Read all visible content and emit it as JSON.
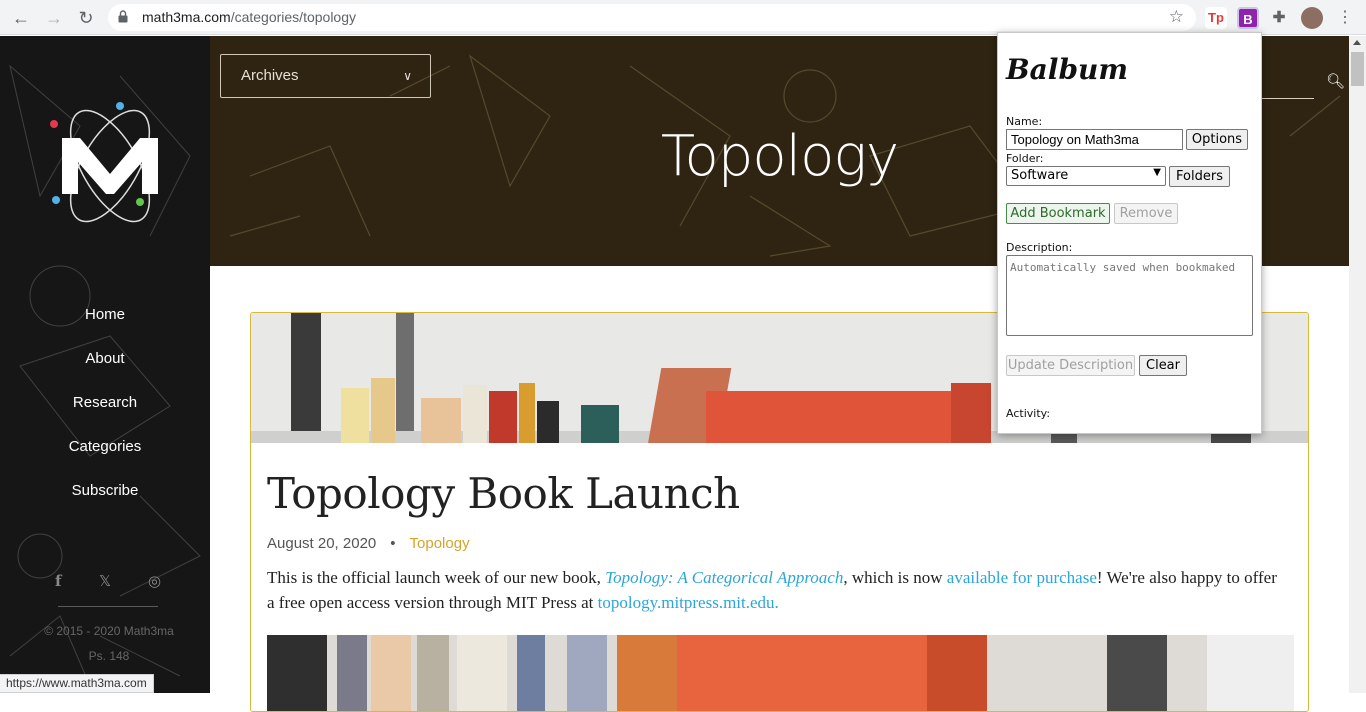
{
  "browser": {
    "url_host": "math3ma.com",
    "url_path": "/categories/topology",
    "status_url": "https://www.math3ma.com",
    "extensions": [
      "Tp",
      "B"
    ]
  },
  "sidebar": {
    "logo_letter": "M",
    "menu": [
      "Home",
      "About",
      "Research",
      "Categories",
      "Subscribe"
    ],
    "social": [
      "f",
      "𝕏",
      "◎"
    ],
    "copyright": "© 2015 - 2020 Math3ma",
    "verse": "Ps. 148"
  },
  "header": {
    "archives_label": "Archives",
    "title": "Topology"
  },
  "article": {
    "title": "Topology Book Launch",
    "date": "August 20, 2020",
    "bullet": "•",
    "category": "Topology",
    "p1_a": "This is the official launch week of our new book, ",
    "p1_book": "Topology: A Categorical Approach",
    "p1_b": ", which is now ",
    "p1_link": "available for purchase",
    "p1_c": "! We're also happy to offer a free open access version through MIT Press at ",
    "p1_link2": "topology.mitpress.mit.edu."
  },
  "popup": {
    "brand": "Balbum",
    "name_label": "Name:",
    "name_value": "Topology on Math3ma",
    "options_btn": "Options",
    "folder_label": "Folder:",
    "folder_value": "Software",
    "folders_btn": "Folders",
    "add_btn": "Add Bookmark",
    "remove_btn": "Remove",
    "desc_label": "Description:",
    "desc_placeholder": "Automatically saved when bookmaked",
    "update_btn": "Update Description",
    "clear_btn": "Clear",
    "activity_label": "Activity:"
  },
  "colors": {
    "banner": "#2f2412",
    "sidebar": "#161616",
    "accent_gold": "#d4a52a",
    "link_blue": "#2aa6d8"
  }
}
